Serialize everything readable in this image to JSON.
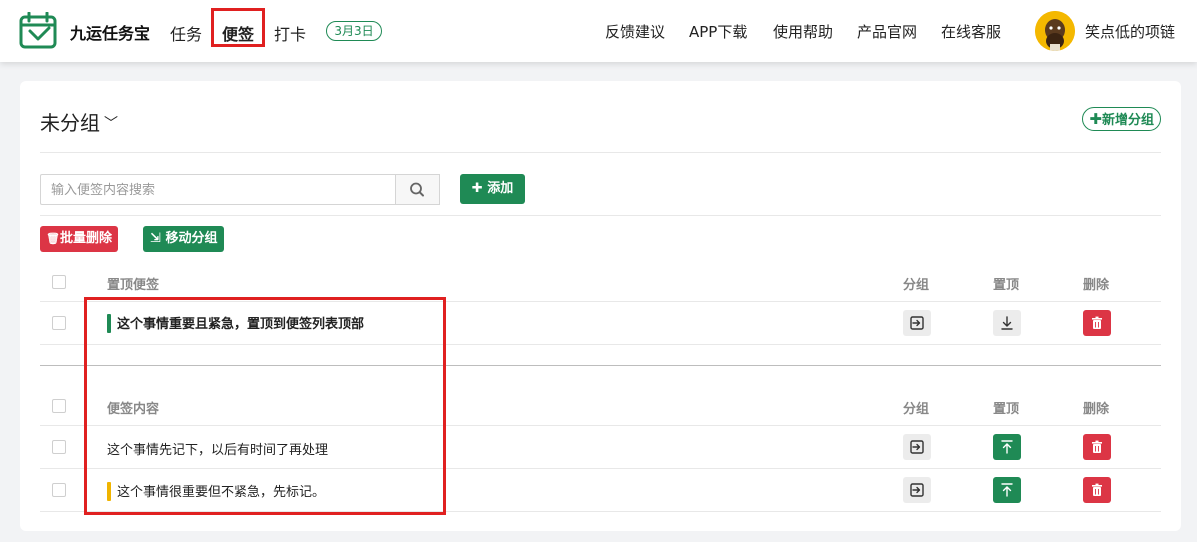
{
  "header": {
    "brand": "九运任务宝",
    "nav": [
      {
        "label": "任务"
      },
      {
        "label": "便签"
      },
      {
        "label": "打卡"
      }
    ],
    "date_badge": "3月3日",
    "links": [
      "反馈建议",
      "APP下载",
      "使用帮助",
      "产品官网",
      "在线客服"
    ],
    "username": "笑点低的项链"
  },
  "group": {
    "title": "未分组",
    "new_group_label": "新增分组"
  },
  "search": {
    "placeholder": "输入便签内容搜索",
    "value": ""
  },
  "actions": {
    "add_label": "添加",
    "batch_delete_label": "批量删除",
    "move_group_label": "移动分组"
  },
  "pinned_table": {
    "headers": [
      "置顶便签",
      "分组",
      "置顶",
      "删除"
    ],
    "rows": [
      {
        "text": "这个事情重要且紧急，置顶到便签列表顶部",
        "bar_color": "#1f8a55",
        "bold": true
      }
    ]
  },
  "notes_table": {
    "headers": [
      "便签内容",
      "分组",
      "置顶",
      "删除"
    ],
    "rows": [
      {
        "text": "这个事情先记下，以后有时间了再处理",
        "bar_color": ""
      },
      {
        "text": "这个事情很重要但不紧急，先标记。",
        "bar_color": "#f0b400"
      }
    ]
  },
  "colors": {
    "brand_green": "#1f8a55",
    "danger_red": "#dc3545",
    "highlight_red": "#e02020"
  }
}
